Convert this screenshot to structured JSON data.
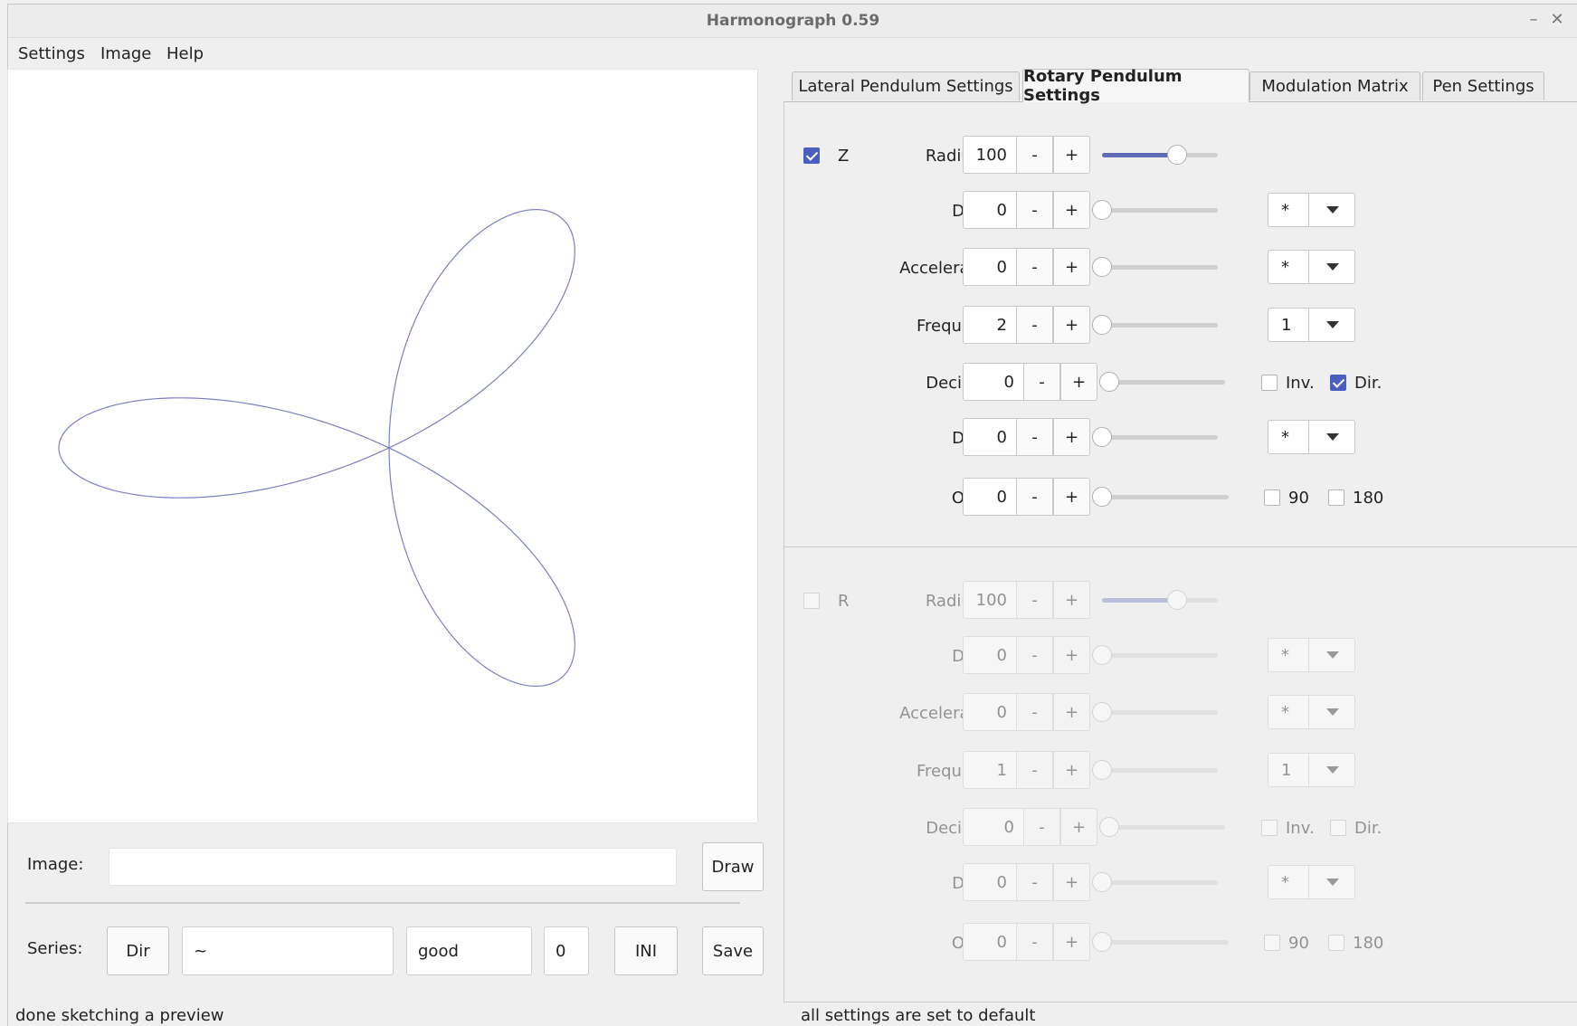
{
  "window": {
    "title": "Harmonograph 0.59",
    "minimize": "–",
    "close": "✕"
  },
  "menu": [
    "Settings",
    "Image",
    "Help"
  ],
  "bottom": {
    "image_label": "Image:",
    "image_value": "",
    "draw_label": "Draw",
    "series_label": "Series:",
    "dir_label": "Dir",
    "path_value": "~",
    "name_value": "good",
    "index_value": "0",
    "ini_label": "INI",
    "save_label": "Save"
  },
  "status": {
    "left": "done sketching a preview",
    "right": "all settings are set to default"
  },
  "tabs": [
    {
      "label": "Lateral Pendulum Settings",
      "active": false
    },
    {
      "label": "Rotary Pendulum Settings",
      "active": true
    },
    {
      "label": "Modulation Matrix",
      "active": false
    },
    {
      "label": "Pen Settings",
      "active": false
    }
  ],
  "spin": {
    "minus": "-",
    "plus": "+"
  },
  "pendulums": [
    {
      "name": "Z",
      "enabled": true,
      "rows": {
        "radius": {
          "label": "Radius %",
          "value": "100",
          "level": 0.65
        },
        "damp": {
          "label": "Damp",
          "value": "0",
          "combo": "*"
        },
        "acceleration": {
          "label": "Acceleration",
          "value": "0",
          "combo": "*"
        },
        "frequency": {
          "label": "Frequency",
          "value": "2",
          "combo": "1"
        },
        "decimals": {
          "label": "Decimals",
          "value": "0",
          "inv_label": "Inv.",
          "inv": false,
          "dir_label": "Dir.",
          "dir": true
        },
        "damp2": {
          "label": "Damp",
          "value": "0",
          "combo": "*"
        },
        "offset": {
          "label": "Offset",
          "value": "0",
          "o90_label": "90",
          "o90": false,
          "o180_label": "180",
          "o180": false
        }
      }
    },
    {
      "name": "R",
      "enabled": false,
      "rows": {
        "radius": {
          "label": "Radius %",
          "value": "100",
          "level": 0.65
        },
        "damp": {
          "label": "Damp",
          "value": "0",
          "combo": "*"
        },
        "acceleration": {
          "label": "Acceleration",
          "value": "0",
          "combo": "*"
        },
        "frequency": {
          "label": "Frequency",
          "value": "1",
          "combo": "1"
        },
        "decimals": {
          "label": "Decimals",
          "value": "0",
          "inv_label": "Inv.",
          "inv": false,
          "dir_label": "Dir.",
          "dir": false
        },
        "damp2": {
          "label": "Damp",
          "value": "0",
          "combo": "*"
        },
        "offset": {
          "label": "Offset",
          "value": "0",
          "o90_label": "90",
          "o90": false,
          "o180_label": "180",
          "o180": false
        }
      }
    }
  ],
  "colors": {
    "accent": "#4a5ec0",
    "curve": "#7a80c0"
  }
}
